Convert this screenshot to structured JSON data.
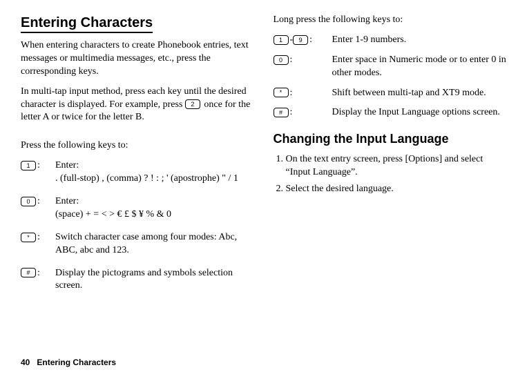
{
  "left": {
    "title": "Entering Characters",
    "para1": "When entering characters to create Phonebook entries, text messages or multimedia messages, etc., press the corresponding keys.",
    "para2a": "In multi-tap input method, press each key until the desired character is displayed. For example, press ",
    "para2b": " once for the letter A or twice for the letter B.",
    "key2": "2",
    "pressHeader": "Press the following keys to:",
    "rows": [
      {
        "icon": "1",
        "lead": "Enter:",
        "text": ". (full-stop) , (comma) ? ! : ; ' (apostrophe) \" / 1"
      },
      {
        "icon": "0",
        "lead": "Enter:",
        "text": "(space) + = < > € £ $ ¥ % & 0"
      },
      {
        "icon": "*",
        "lead": "",
        "text": "Switch character case among four modes: Abc, ABC, abc and 123."
      },
      {
        "icon": "#",
        "lead": "",
        "text": "Display the pictograms and symbols selection screen."
      }
    ]
  },
  "right": {
    "longHeader": "Long press the following keys to:",
    "rows": [
      {
        "icon1": "1",
        "dash": "-",
        "icon2": "9",
        "text": "Enter 1-9 numbers."
      },
      {
        "icon": "0",
        "text": "Enter space in Numeric mode or to enter 0 in other modes."
      },
      {
        "icon": "*",
        "text": "Shift between multi-tap and XT9 mode."
      },
      {
        "icon": "#",
        "text": "Display the Input Language options screen."
      }
    ],
    "subtitle": "Changing the Input Language",
    "step1": "On the text entry screen, press [Options] and select “Input Language”.",
    "step2": "Select the desired language."
  },
  "footer": {
    "pageno": "40",
    "section": "Entering Characters"
  }
}
